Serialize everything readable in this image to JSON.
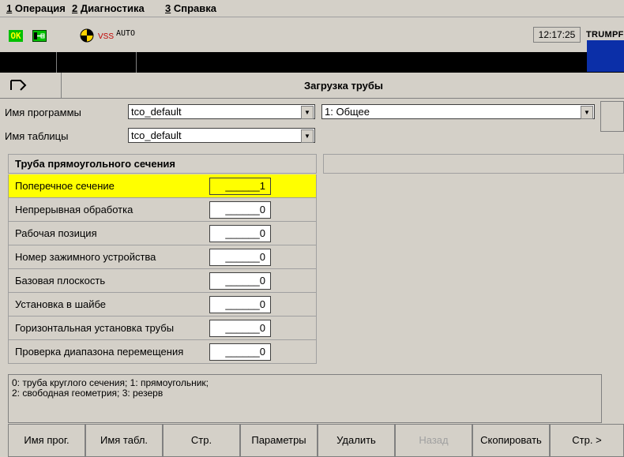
{
  "menu": [
    {
      "key": "1",
      "label": "Операция"
    },
    {
      "key": "2",
      "label": "Диагностика"
    },
    {
      "key": "3",
      "label": "Справка"
    }
  ],
  "status": {
    "ok_label": "OK",
    "vss_label": "VSS",
    "mode_label": "AUTO",
    "time": "12:17:25",
    "logo": "TRUMPF",
    "logo_color": "#0b2fa8"
  },
  "page_title": "Загрузка трубы",
  "program": {
    "label": "Имя программы",
    "value": "tco_default",
    "category": "1: Общее"
  },
  "table": {
    "label": "Имя таблицы",
    "value": "tco_default"
  },
  "section_title": "Труба прямоугольного сечения",
  "params": [
    {
      "label": "Поперечное сечение",
      "value": "______1",
      "selected": true
    },
    {
      "label": "Непрерывная обработка",
      "value": "______0"
    },
    {
      "label": "Рабочая позиция",
      "value": "______0"
    },
    {
      "label": "Номер зажимного устройства",
      "value": "______0"
    },
    {
      "label": "Базовая плоскость",
      "value": "______0"
    },
    {
      "label": "Установка в шайбе",
      "value": "______0"
    },
    {
      "label": "Горизонтальная установка трубы",
      "value": "______0"
    },
    {
      "label": "Проверка диапазона перемещения",
      "value": "______0"
    }
  ],
  "help_lines": [
    "0: труба круглого сечения; 1: прямоугольник;",
    "2: свободная геометрия; 3: резерв"
  ],
  "softkeys": [
    {
      "label": "Имя прог."
    },
    {
      "label": "Имя табл."
    },
    {
      "label": "Стр."
    },
    {
      "label": "Параметры"
    },
    {
      "label": "Удалить"
    },
    {
      "label": "Назад",
      "disabled": true
    },
    {
      "label": "Скопировать"
    },
    {
      "label": "Стр. >"
    }
  ],
  "colors": {
    "selected_row": "#ffff00",
    "background": "#d4d0c8"
  }
}
